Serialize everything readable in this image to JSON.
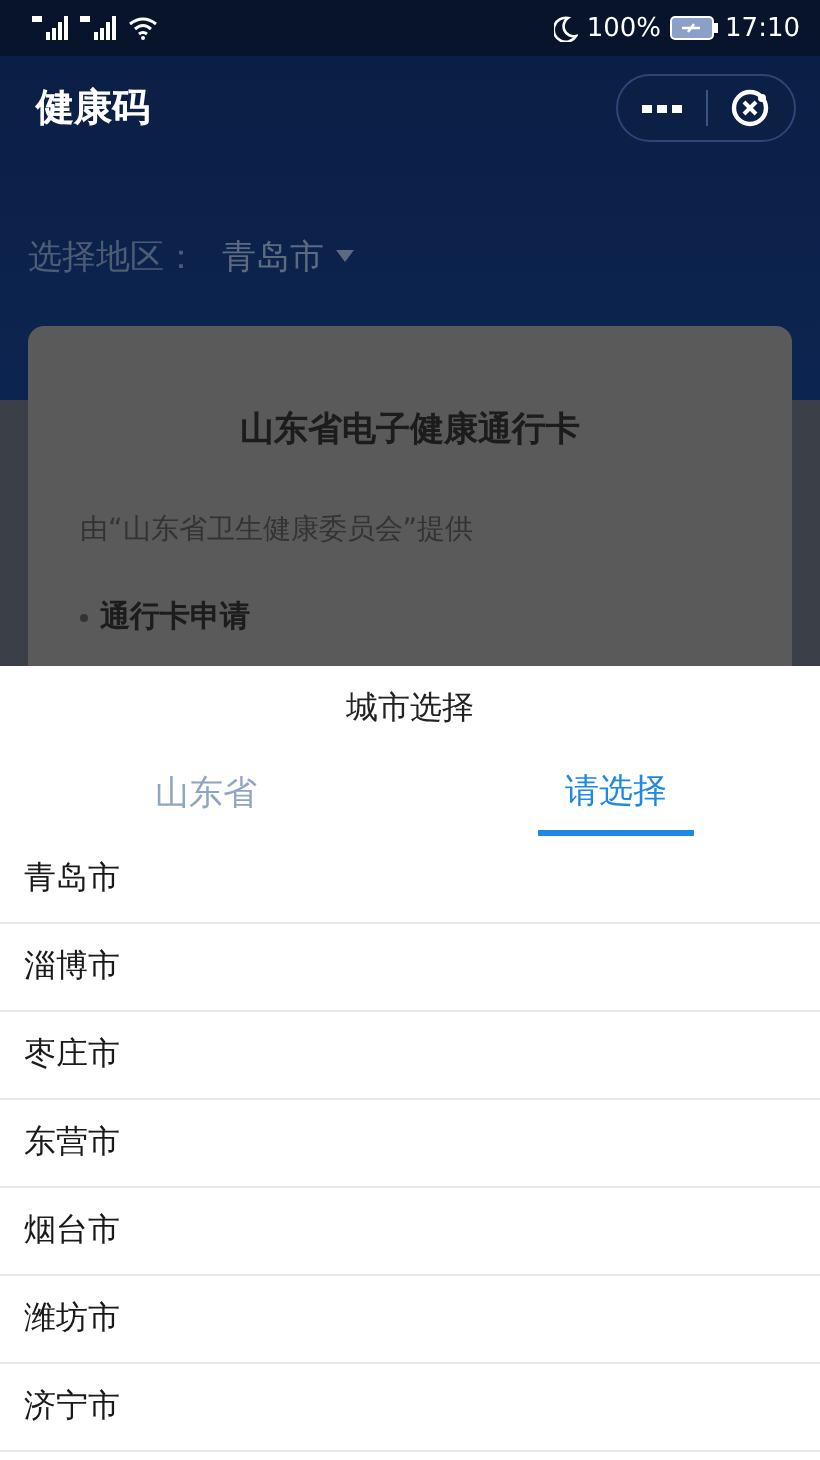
{
  "status_bar": {
    "battery": "100%",
    "time": "17:10"
  },
  "header": {
    "title": "健康码"
  },
  "region": {
    "label": "选择地区：",
    "value": "青岛市"
  },
  "card": {
    "title": "山东省电子健康通行卡",
    "provider": "由“山东省卫生健康委员会”提供",
    "items": [
      "通行卡申请"
    ]
  },
  "sheet": {
    "title": "城市选择",
    "tabs": [
      {
        "label": "山东省",
        "selected": false
      },
      {
        "label": "请选择",
        "selected": true
      }
    ],
    "cities": [
      "青岛市",
      "淄博市",
      "枣庄市",
      "东营市",
      "烟台市",
      "潍坊市",
      "济宁市"
    ]
  }
}
